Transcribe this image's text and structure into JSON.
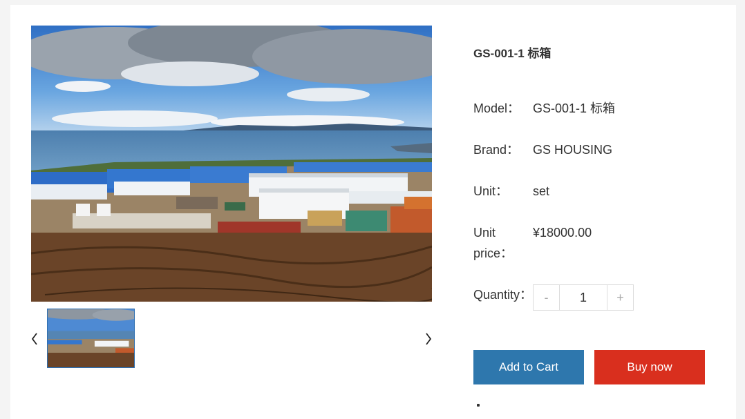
{
  "product": {
    "title": "GS-001-1 标箱",
    "image_alt": "Prefabricated container camp by the lake",
    "fields": {
      "model_label": "Model：",
      "model_value": "GS-001-1 标箱",
      "brand_label": "Brand：",
      "brand_value": "GS HOUSING",
      "unit_label": "Unit：",
      "unit_value": "set",
      "price_label": "Unit price：",
      "price_value": "¥18000.00",
      "quantity_label": "Quantity："
    },
    "quantity": {
      "minus": "-",
      "value": "1",
      "plus": "+"
    },
    "buttons": {
      "add_to_cart": "Add to Cart",
      "buy_now": "Buy now"
    }
  },
  "colors": {
    "add_to_cart": "#2e77ad",
    "buy_now": "#d92f1e",
    "thumb_border": "#2f6fb0"
  },
  "icons": {
    "prev": "chevron-left-icon",
    "next": "chevron-right-icon"
  }
}
